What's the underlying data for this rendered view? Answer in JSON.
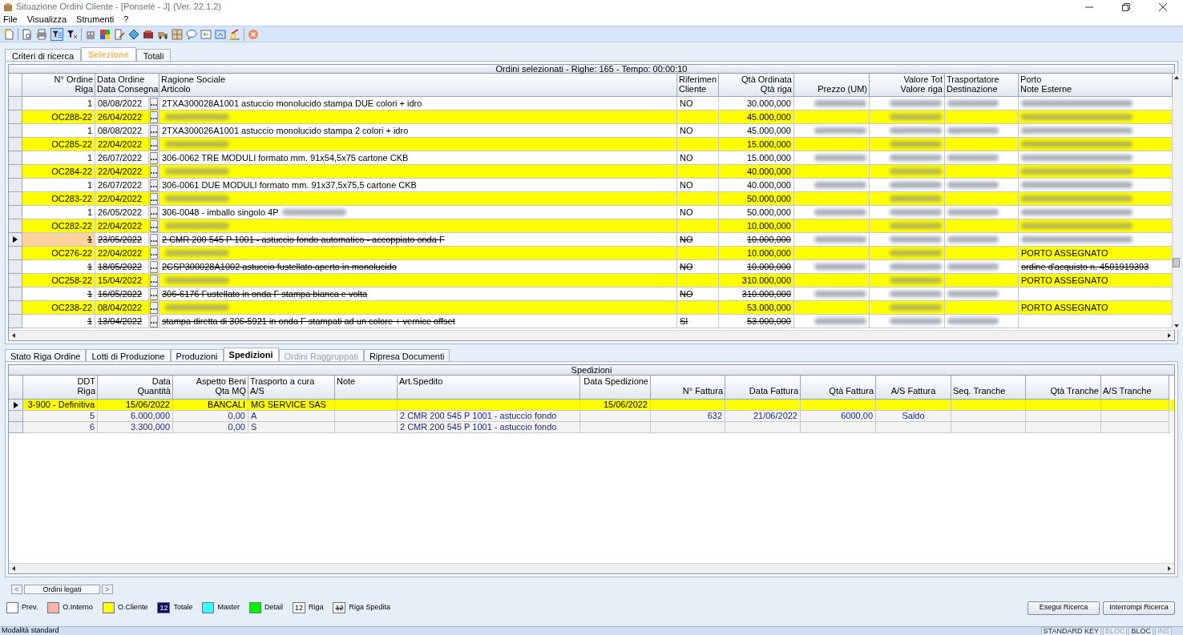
{
  "window": {
    "title": "Situazione Ordini Cliente - [Ponselè - J]",
    "version": "(Ver. 22.1.2)"
  },
  "menu": [
    "File",
    "Visualizza",
    "Strumenti",
    "?"
  ],
  "tabs": [
    {
      "label": "Criteri di ricerca",
      "selected": false
    },
    {
      "label": "Selezione",
      "selected": true
    },
    {
      "label": "Totali",
      "selected": false
    }
  ],
  "orders_grid": {
    "title": "Ordini selezionati - Righe: 165 - Tempo: 00:00:10",
    "columns": [
      [
        "N° Ordine",
        "Riga"
      ],
      [
        "Data Ordine",
        "Data Consegna"
      ],
      [
        "Ragione Sociale",
        "Articolo"
      ],
      [
        "Riferimen",
        "Cliente"
      ],
      [
        "Qtà Ordinata",
        "Qtà riga"
      ],
      [
        "Prezzo (UM)"
      ],
      [
        "Valore Tot",
        "Valore riga"
      ],
      [
        "Trasportatore",
        "Destinazione"
      ],
      [
        "Porto",
        "Note Esterne"
      ]
    ],
    "rows": [
      {
        "kind": "riga",
        "selected": false,
        "shipped": false,
        "num": "1",
        "date": "08/08/2022",
        "button": "...",
        "article": "2TXA300028A1001  astuccio monolucido stampa DUE colori + idro",
        "rif": "NO",
        "qta": "30.000,000",
        "redacted": {
          "prezzo": true,
          "valore": true,
          "trasp": true,
          "porto": true
        }
      },
      {
        "kind": "ordine",
        "selected": false,
        "shipped": false,
        "num": "OC288-22",
        "date": "26/04/2022",
        "button": "...",
        "qta": "45.000,000",
        "redacted": {
          "article": true,
          "valore": true,
          "porto": true
        }
      },
      {
        "kind": "riga",
        "selected": false,
        "shipped": false,
        "num": "1",
        "date": "08/08/2022",
        "button": "...",
        "article": "2TXA300026A1001 astuccio monolucido stampa 2 colori + idro",
        "rif": "NO",
        "qta": "45.000,000",
        "redacted": {
          "prezzo": true,
          "valore": true,
          "trasp": true,
          "porto": true
        }
      },
      {
        "kind": "ordine",
        "selected": false,
        "shipped": false,
        "num": "OC285-22",
        "date": "22/04/2022",
        "button": "...",
        "qta": "15.000,000",
        "redacted": {
          "article": true,
          "valore": true,
          "porto": true
        }
      },
      {
        "kind": "riga",
        "selected": false,
        "shipped": false,
        "num": "1",
        "date": "26/07/2022",
        "button": "...",
        "article": "306-0062 TRE MODULI formato mm. 91x54,5x75 cartone CKB",
        "rif": "NO",
        "qta": "15.000,000",
        "redacted": {
          "prezzo": true,
          "valore": true,
          "trasp": true,
          "porto": true
        }
      },
      {
        "kind": "ordine",
        "selected": false,
        "shipped": false,
        "num": "OC284-22",
        "date": "22/04/2022",
        "button": "...",
        "qta": "40.000,000",
        "redacted": {
          "article": true,
          "valore": true,
          "porto": true
        }
      },
      {
        "kind": "riga",
        "selected": false,
        "shipped": false,
        "num": "1",
        "date": "26/07/2022",
        "button": "...",
        "article": "306-0061 DUE MODULI formato mm. 91x37,5x75,5 cartone CKB",
        "rif": "NO",
        "qta": "40.000,000",
        "redacted": {
          "prezzo": true,
          "valore": true,
          "trasp": true,
          "porto": true
        }
      },
      {
        "kind": "ordine",
        "selected": false,
        "shipped": false,
        "num": "OC283-22",
        "date": "22/04/2022",
        "button": "...",
        "qta": "50.000,000",
        "redacted": {
          "article": true,
          "valore": true,
          "porto": true
        }
      },
      {
        "kind": "riga",
        "selected": false,
        "shipped": false,
        "num": "1",
        "date": "26/05/2022",
        "button": "...",
        "article": "306-0048 - imballo singolo 4P",
        "rif": "NO",
        "qta": "50.000,000",
        "redacted": {
          "article": true,
          "prezzo": true,
          "valore": true,
          "trasp": true,
          "porto": true
        }
      },
      {
        "kind": "ordine",
        "selected": false,
        "shipped": false,
        "num": "OC282-22",
        "date": "22/04/2022",
        "button": "...",
        "qta": "10.000,000",
        "redacted": {
          "article": true,
          "valore": true,
          "porto": true
        }
      },
      {
        "kind": "riga",
        "selected": true,
        "shipped": true,
        "num": "1",
        "date": "23/05/2022",
        "button": "...",
        "article": "2 CMR 200 545 P 1001 - astuccio fondo automatico - accoppiato onda F",
        "rif": "NO",
        "qta": "10.000,000",
        "redacted": {
          "prezzo": true,
          "valore": true,
          "trasp": true,
          "porto": true
        }
      },
      {
        "kind": "ordine",
        "selected": false,
        "shipped": false,
        "num": "OC276-22",
        "date": "22/04/2022",
        "button": "...",
        "qta": "10.000,000",
        "porto": "PORTO ASSEGNATO",
        "redacted": {
          "article": true,
          "valore": true
        }
      },
      {
        "kind": "riga",
        "selected": false,
        "shipped": true,
        "num": "1",
        "date": "18/05/2022",
        "button": "...",
        "article": "2CSP300028A1002 astuccio fustellato aperto in monolucido",
        "rif": "NO",
        "qta": "10.000,000",
        "porto": "ordine d'acquisto n. 4501919393",
        "redacted": {
          "prezzo": true,
          "valore": true,
          "trasp": true
        }
      },
      {
        "kind": "ordine",
        "selected": false,
        "shipped": false,
        "num": "OC258-22",
        "date": "15/04/2022",
        "button": "...",
        "qta": "310.000,000",
        "porto": "PORTO ASSEGNATO",
        "redacted": {
          "article": true,
          "valore": true
        }
      },
      {
        "kind": "riga",
        "selected": false,
        "shipped": true,
        "num": "1",
        "date": "16/05/2022",
        "button": "...",
        "article": "306-6176  Fustellato in onda F stampa bianca e volta",
        "rif": "NO",
        "qta": "310.000,000",
        "redacted": {
          "prezzo": true,
          "valore": true,
          "trasp": true
        }
      },
      {
        "kind": "ordine",
        "selected": false,
        "shipped": false,
        "num": "OC238-22",
        "date": "08/04/2022",
        "button": "...",
        "qta": "53.000,000",
        "porto": "PORTO ASSEGNATO",
        "redacted": {
          "article": true,
          "valore": true
        }
      },
      {
        "kind": "riga",
        "selected": false,
        "shipped": true,
        "num": "1",
        "date": "13/04/2022",
        "button": "...",
        "article": "stampa diretta di 306-5921 in onda F stampati ad un colore + vernice offset",
        "rif": "SI",
        "qta": "53.000,000",
        "redacted": {
          "prezzo": true,
          "valore": true,
          "trasp": true
        }
      }
    ]
  },
  "detail_tabs": [
    {
      "label": "Stato Riga Ordine",
      "selected": false,
      "disabled": false
    },
    {
      "label": "Lotti di Produzione",
      "selected": false,
      "disabled": false
    },
    {
      "label": "Produzioni",
      "selected": false,
      "disabled": false
    },
    {
      "label": "Spedizioni",
      "selected": true,
      "disabled": false
    },
    {
      "label": "Ordini Raggruppati",
      "selected": false,
      "disabled": true
    },
    {
      "label": "Ripresa Documenti",
      "selected": false,
      "disabled": false
    }
  ],
  "shipments_grid": {
    "title": "Spedizioni",
    "columns": [
      [
        "DDT",
        "Riga"
      ],
      [
        "Data",
        "Quantità"
      ],
      [
        "Aspetto Beni",
        "Qta MQ"
      ],
      [
        "Trasporto a cura",
        "A/S"
      ],
      [
        "Note"
      ],
      [
        "Art.Spedito"
      ],
      [
        "Data Spedizione"
      ],
      [
        "N° Fattura"
      ],
      [
        "Data Fattura"
      ],
      [
        "Qtà Fattura"
      ],
      [
        "A/S Fattura"
      ],
      [
        "Seq. Tranche"
      ],
      [
        "Qtà Tranche"
      ],
      [
        "A/S Tranche"
      ]
    ],
    "rows": [
      {
        "kind": "ddt",
        "selected": true,
        "ddt": "3-900 - Definitiva",
        "data": "15/06/2022",
        "aspetto": "BANCALI",
        "trasporto": "MG SERVICE SAS",
        "data_spedizione": "15/06/2022"
      },
      {
        "kind": "riga",
        "selected": false,
        "ddt": "5",
        "data": "6.000,000",
        "aspetto": "0,00",
        "trasporto": "A",
        "articolo": "2 CMR 200 545 P 1001 - astuccio fondo",
        "fattura": "632",
        "data_fattura": "21/06/2022",
        "qta_fattura": "6000,00",
        "as_fattura": "Saldo"
      },
      {
        "kind": "riga",
        "selected": false,
        "ddt": "6",
        "data": "3.300,000",
        "aspetto": "0,00",
        "trasporto": "S",
        "articolo": "2 CMR 200 545 P 1001 - astuccio fondo"
      }
    ]
  },
  "linked_nav": {
    "prev": "<",
    "label": "Ordini legati",
    "next": ">"
  },
  "legend": [
    {
      "kind": "swatch",
      "color": "#ffffff",
      "label": "Prev."
    },
    {
      "kind": "swatch",
      "color": "#f8b4a8",
      "label": "O.Interno"
    },
    {
      "kind": "swatch",
      "color": "#ffff00",
      "label": "O.Cliente"
    },
    {
      "kind": "totale",
      "text": "12",
      "label": "Totale"
    },
    {
      "kind": "swatch",
      "color": "#33ffff",
      "label": "Master"
    },
    {
      "kind": "swatch",
      "color": "#00ee00",
      "label": "Detail"
    },
    {
      "kind": "riga",
      "text": "12",
      "label": "Riga"
    },
    {
      "kind": "riga_spedita",
      "text": "12",
      "label": "Riga Spedita"
    }
  ],
  "buttons": [
    "Esegui Ricerca",
    "Interrompi Ricerca"
  ],
  "status_bar": {
    "mode": "Modalità standard",
    "panels": [
      {
        "text": "STANDARD KEY",
        "disabled": false
      },
      {
        "text": "BLOC",
        "disabled": true
      },
      {
        "text": "BLOC",
        "disabled": false
      },
      {
        "text": "INS",
        "disabled": true
      }
    ]
  }
}
